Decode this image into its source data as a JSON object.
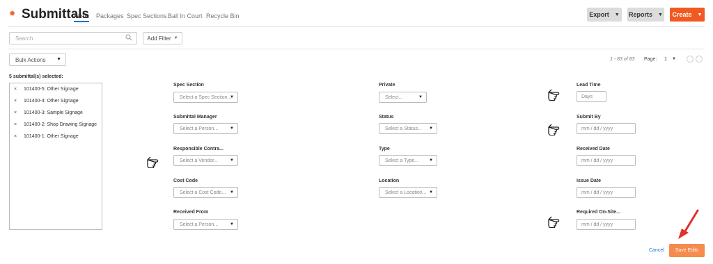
{
  "header": {
    "title": "Submittals",
    "tabs": [
      "Items",
      "Packages",
      "Spec Sections",
      "Ball In Court",
      "Recycle Bin"
    ],
    "export_label": "Export",
    "reports_label": "Reports",
    "create_label": "Create"
  },
  "toolbar": {
    "search_placeholder": "Search",
    "add_filter_label": "Add Filter",
    "bulk_actions_label": "Bulk Actions"
  },
  "pager": {
    "count": "1 - 83 of 83",
    "page_label": "Page:",
    "page_value": "1"
  },
  "selection": {
    "title": "5 submittal(s) selected:",
    "items": [
      "101400-5: Other Signage",
      "101400-4: Other Signage",
      "101400-3: Sample Signage",
      "101400-2: Shop Drawing Signage",
      "101400-1: Other Signage"
    ]
  },
  "fields": {
    "spec_section": {
      "label": "Spec Section",
      "value": "Select a Spec Section..."
    },
    "submittal_manager": {
      "label": "Submittal Manager",
      "value": "Select a Person..."
    },
    "responsible_contractor": {
      "label": "Responsible Contra...",
      "value": "Select a Vendor..."
    },
    "cost_code": {
      "label": "Cost Code",
      "value": "Select a Cost Code..."
    },
    "received_from": {
      "label": "Received From",
      "value": "Select a Person..."
    },
    "private": {
      "label": "Private",
      "value": "Select..."
    },
    "status": {
      "label": "Status",
      "value": "Select a Status..."
    },
    "type": {
      "label": "Type",
      "value": "Select a Type..."
    },
    "location": {
      "label": "Location",
      "value": "Select a Location..."
    },
    "lead_time": {
      "label": "Lead Time",
      "placeholder": "Days"
    },
    "submit_by": {
      "label": "Submit By",
      "placeholder": "mm  /  dd  /  yyyy"
    },
    "received_date": {
      "label": "Received Date",
      "placeholder": "mm  /  dd  /  yyyy"
    },
    "issue_date": {
      "label": "Issue Date",
      "placeholder": "mm  /  dd  /  yyyy"
    },
    "required_onsite": {
      "label": "Required On-Site...",
      "placeholder": "mm  /  dd  /  yyyy"
    }
  },
  "footer": {
    "cancel_label": "Cancel",
    "save_label": "Save Edits"
  },
  "colors": {
    "accent": "#f05a22",
    "save": "#f58b4c",
    "link": "#1a73c7",
    "arrow": "#e0312b"
  },
  "icons": [
    "gear-icon",
    "search-icon",
    "pointing-hand-icon",
    "red-arrow-icon"
  ]
}
